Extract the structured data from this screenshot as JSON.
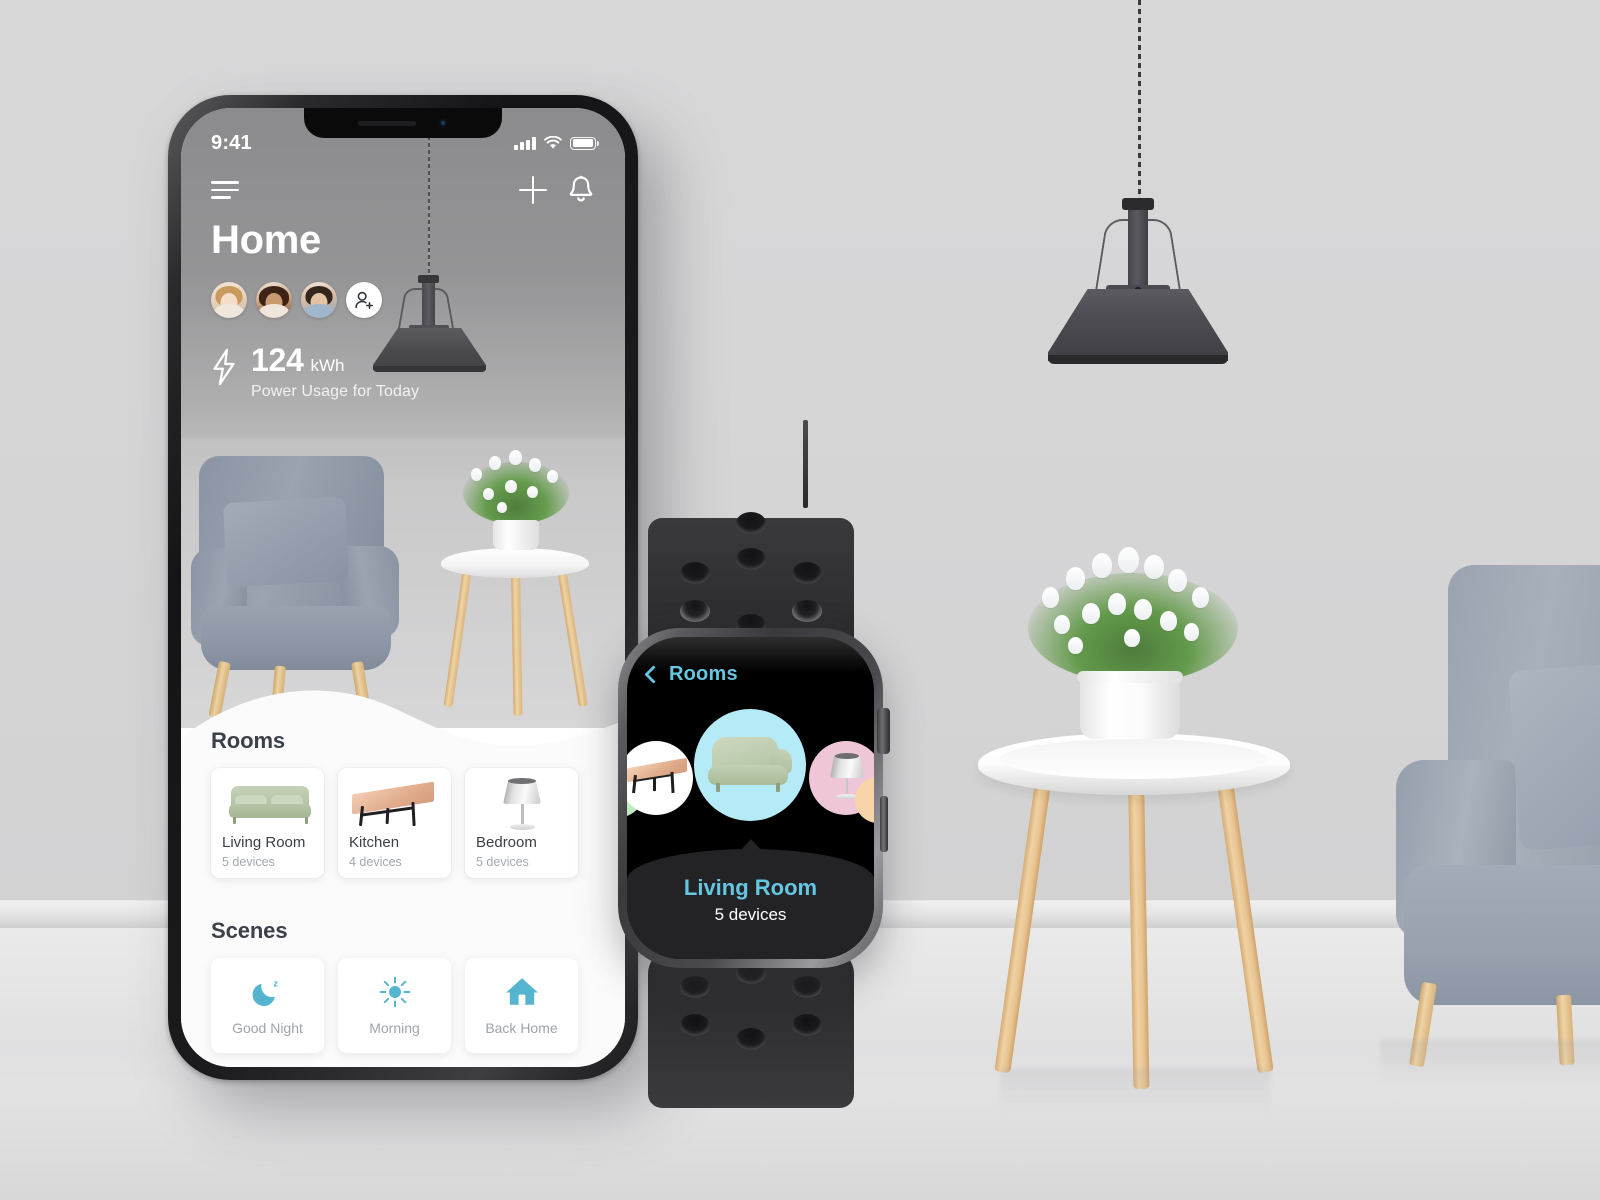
{
  "background_scene": {
    "wall_color": "#d5d5d6",
    "floor_color": "#dededf",
    "objects": [
      "pendant-lamp",
      "side-table",
      "potted-plant",
      "armchair"
    ]
  },
  "phone": {
    "status_bar": {
      "time": "9:41",
      "icons": [
        "cellular-signal-icon",
        "wifi-icon",
        "battery-icon"
      ]
    },
    "nav": {
      "menu_icon": "hamburger-menu-icon",
      "add_icon": "plus-icon",
      "notification_icon": "bell-icon"
    },
    "page_title": "Home",
    "members": [
      {
        "name": "member-1"
      },
      {
        "name": "member-2"
      },
      {
        "name": "member-3"
      }
    ],
    "add_member_label": "add-person-icon",
    "power": {
      "icon": "lightning-bolt-icon",
      "value": "124",
      "unit": "kWh",
      "caption": "Power Usage for Today"
    },
    "rooms_section": {
      "title": "Rooms",
      "cards": [
        {
          "name": "Living Room",
          "devices": "5 devices",
          "thumb": "sofa-thumb"
        },
        {
          "name": "Kitchen",
          "devices": "4 devices",
          "thumb": "table-thumb"
        },
        {
          "name": "Bedroom",
          "devices": "5 devices",
          "thumb": "lamp-thumb"
        }
      ]
    },
    "scenes_section": {
      "title": "Scenes",
      "cards": [
        {
          "label": "Good Night",
          "icon": "moon-icon"
        },
        {
          "label": "Morning",
          "icon": "sun-icon"
        },
        {
          "label": "Back Home",
          "icon": "home-icon"
        }
      ]
    },
    "accent_color": "#55b5d0"
  },
  "watch": {
    "nav": {
      "back_icon": "chevron-left-icon",
      "label": "Rooms"
    },
    "carousel": {
      "bubbles": [
        {
          "id": "edge-left",
          "thumb": "green-circle",
          "color": "#bfe9c0"
        },
        {
          "id": "left",
          "thumb": "table-thumb",
          "color": "#ffffff"
        },
        {
          "id": "center",
          "thumb": "sofa-thumb",
          "color": "#b5ebf7"
        },
        {
          "id": "right",
          "thumb": "lamp-thumb",
          "color": "#eec6d7"
        },
        {
          "id": "edge-right",
          "thumb": "peach-circle",
          "color": "#f7d5a8"
        }
      ]
    },
    "selected_room": {
      "name": "Living Room",
      "devices": "5 devices"
    },
    "accent_color": "#64c6e0",
    "controls": [
      "digital-crown",
      "side-button"
    ]
  }
}
